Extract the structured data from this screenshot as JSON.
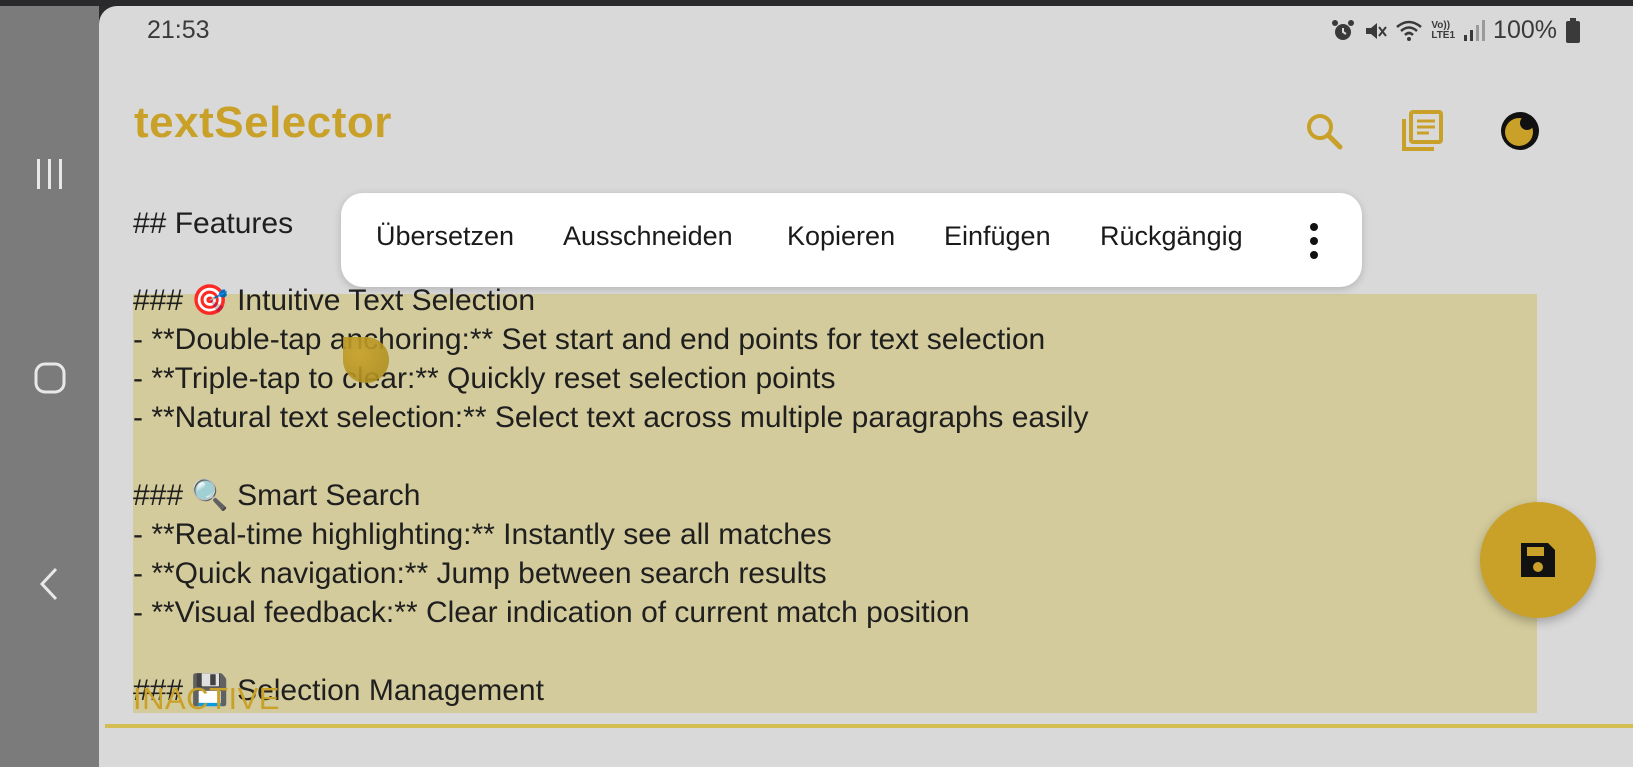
{
  "status": {
    "time": "21:53",
    "battery": "100%",
    "network_label": "LTE1",
    "volte_label": "Vo))"
  },
  "app": {
    "title": "textSelector"
  },
  "editor": {
    "lines": [
      "## Features",
      "### 🎯 Intuitive Text Selection",
      "- **Double-tap anchoring:** Set start and end points for text selection",
      "- **Triple-tap to clear:** Quickly reset selection points",
      "- **Natural text selection:** Select text across multiple paragraphs easily",
      "### 🔍 Smart Search",
      "- **Real-time highlighting:** Instantly see all matches",
      "- **Quick navigation:** Jump between search results",
      "- **Visual feedback:** Clear indication of current match position",
      "### 💾 Selection Management"
    ],
    "status_overlay": "INACTIVE"
  },
  "context_menu": {
    "items": [
      "Übersetzen",
      "Ausschneiden",
      "Kopieren",
      "Einfügen",
      "Rückgängig"
    ]
  },
  "colors": {
    "accent": "#c9a128",
    "selection": "#d3cb9b",
    "background": "#d9d9d9"
  },
  "icons": {
    "search": "search-icon",
    "documents": "documents-icon",
    "theme": "theme-toggle-icon",
    "save": "save-icon",
    "more": "more-vertical-icon"
  }
}
